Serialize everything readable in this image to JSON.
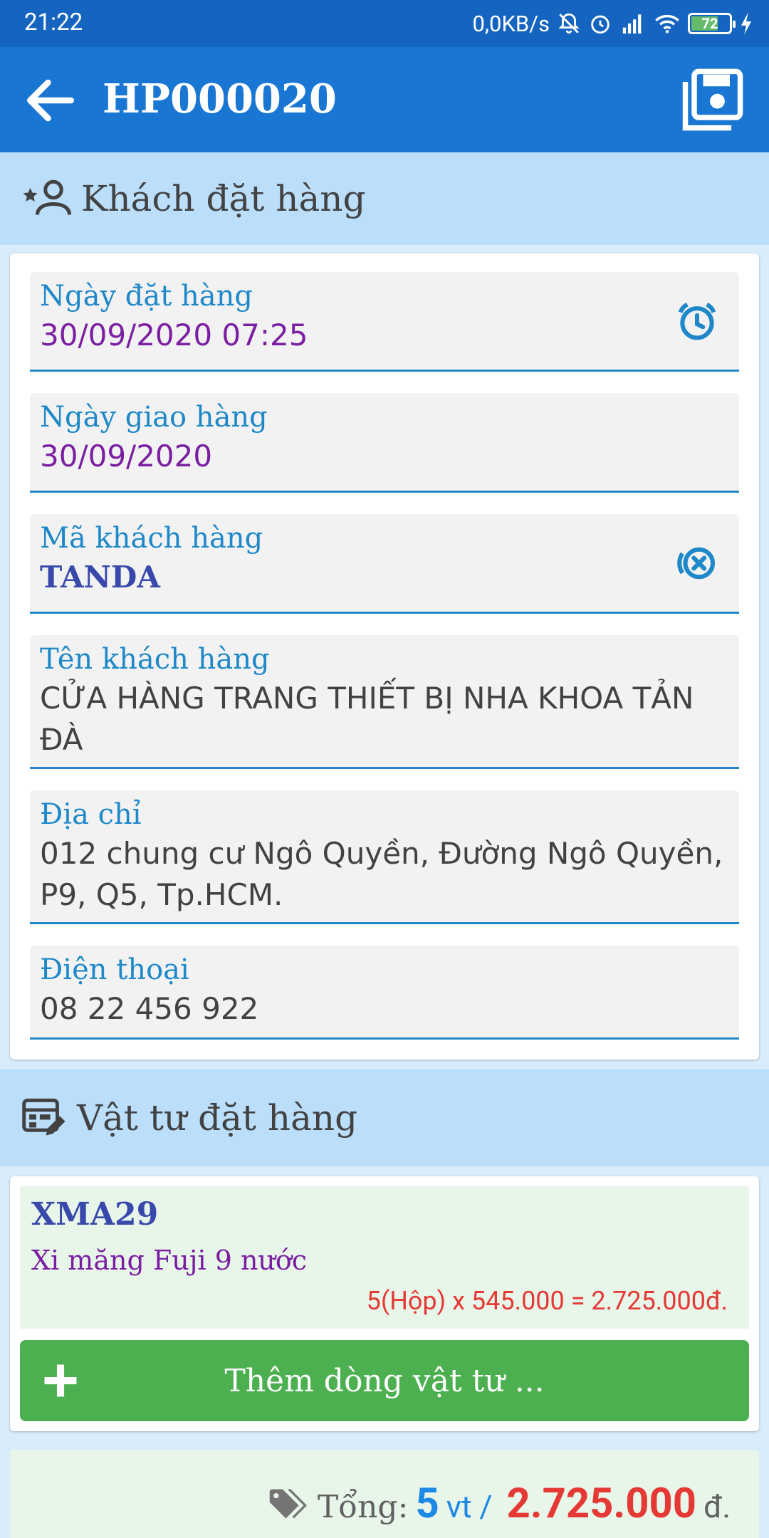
{
  "status": {
    "time": "21:22",
    "net_speed": "0,0KB/s",
    "battery": "72"
  },
  "appbar": {
    "title": "HP000020"
  },
  "customer_section": {
    "title": "Khách đặt hàng",
    "fields": {
      "order_date": {
        "label": "Ngày đặt hàng",
        "value": "30/09/2020 07:25"
      },
      "delivery_date": {
        "label": "Ngày giao hàng",
        "value": "30/09/2020"
      },
      "customer_code": {
        "label": "Mã khách hàng",
        "value": "TANDA"
      },
      "customer_name": {
        "label": "Tên khách hàng",
        "value": "CỬA HÀNG TRANG THIẾT BỊ NHA KHOA TẢN ĐÀ"
      },
      "address": {
        "label": "Địa chỉ",
        "value": "012 chung cư Ngô Quyền, Đường Ngô Quyền, P9, Q5, Tp.HCM."
      },
      "phone": {
        "label": "Điện thoại",
        "value": "08 22 456 922"
      }
    }
  },
  "items_section": {
    "title": "Vật tư đặt hàng",
    "items": [
      {
        "code": "XMA29",
        "name": "Xi măng Fuji 9 nước",
        "calc": "5(Hộp) x 545.000 = 2.725.000đ."
      }
    ],
    "add_button": "Thêm dòng vật tư ..."
  },
  "total": {
    "label": "Tổng:",
    "count": "5",
    "unit": "vt /",
    "amount": "2.725.000",
    "currency": "đ."
  }
}
